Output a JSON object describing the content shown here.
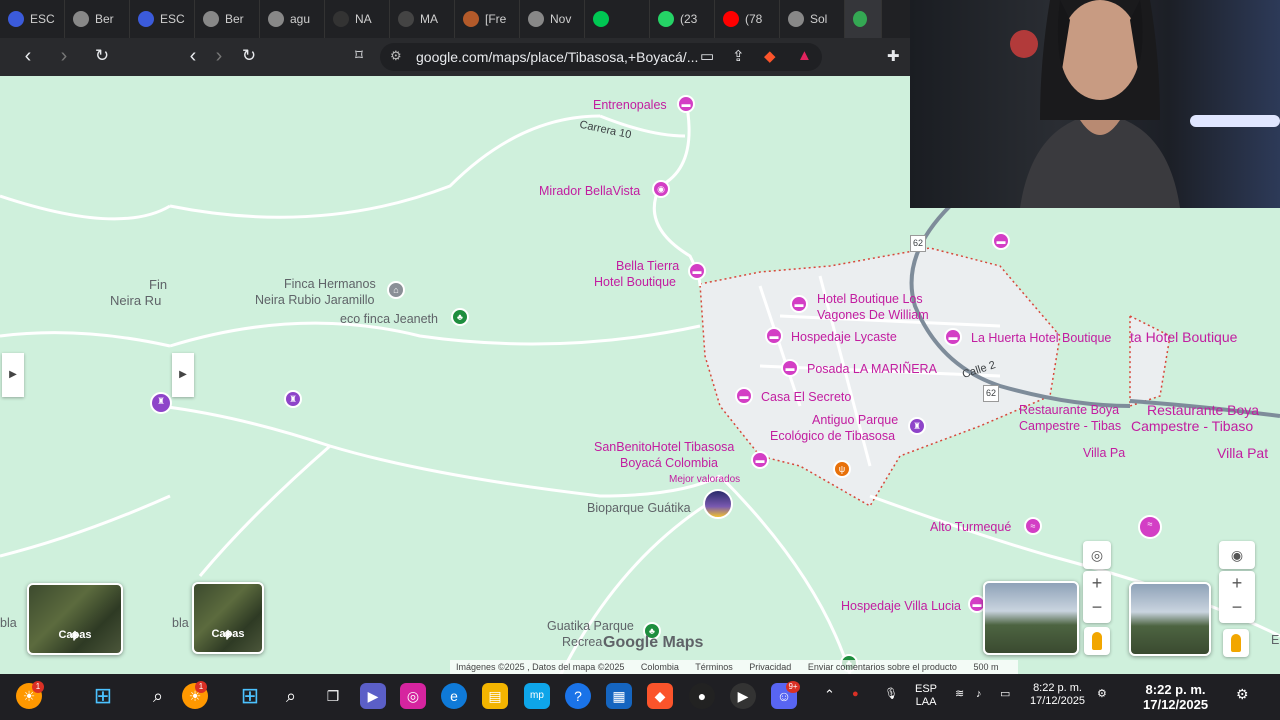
{
  "browser": {
    "tabs": [
      {
        "label": "ESC",
        "color": "#3b5bdb"
      },
      {
        "label": "Ber",
        "color": "#888"
      },
      {
        "label": "ESC",
        "color": "#3b5bdb"
      },
      {
        "label": "Ber",
        "color": "#888"
      },
      {
        "label": "agu",
        "color": "#888"
      },
      {
        "label": "NA",
        "color": "#333"
      },
      {
        "label": "MA",
        "color": "#444"
      },
      {
        "label": "[Fre",
        "color": "#b35a2a"
      },
      {
        "label": "Nov",
        "color": "#888"
      },
      {
        "label": "",
        "color": "#00c853"
      },
      {
        "label": "(23",
        "color": "#25d366"
      },
      {
        "label": "(78",
        "color": "#ff0000"
      },
      {
        "label": "Sol",
        "color": "#888"
      },
      {
        "label": "",
        "color": "#34a853"
      }
    ],
    "url": "google.com/maps/place/Tibasosa,+Boyacá/..."
  },
  "map": {
    "roads": {
      "carrera10": "Carrera 10",
      "calle2": "Calle 2",
      "r62a": "62",
      "r62b": "62"
    },
    "places": {
      "entrenopales": "Entrenopales",
      "mirador": "Mirador BellaVista",
      "bellatierra1": "Bella Tierra",
      "bellatierra2": "Hotel Boutique",
      "finca1": "Finca Hermanos",
      "finca2": "Neira Rubio Jaramillo",
      "ecofinca": "eco finca Jeaneth",
      "fin1": "Fin",
      "fin2": "Neira Ru",
      "hbl1": "Hotel Boutique Los",
      "hbl2": "Vagones De William",
      "lycaste": "Hospedaje Lycaste",
      "lahuerta": "La Huerta Hotel Boutique",
      "lahuerta2": "ta Hotel Boutique",
      "marinera": "Posada LA MARIÑERA",
      "secreto": "Casa El Secreto",
      "parque1": "Antiguo Parque",
      "parque2": "Ecológico de Tibasosa",
      "sanbenito1": "SanBenitoHotel Tibasosa",
      "sanbenito2": "Boyacá Colombia",
      "mejor": "Mejor valorados",
      "bioparque": "Bioparque Guátika",
      "rest1": "Restaurante Boya",
      "rest1b": "Campestre - Tibas",
      "rest2": "Restaurante Boya",
      "rest2b": "Campestre - Tibaso",
      "villapa1": "Villa Pa",
      "villapa2": "Villa Pat",
      "alto": "Alto Turmequé",
      "villalucia": "Hospedaje Villa Lucia",
      "guatika1": "Guatika Parque",
      "guatika2": "Recrea",
      "bla1": "bla",
      "bla2": "bla",
      "e": "E"
    },
    "logo": "Google Maps",
    "layers_label": "Capas",
    "attribution": [
      "Imágenes ©2025 , Datos del mapa ©2025",
      "Colombia",
      "Términos",
      "Privacidad",
      "Enviar comentarios sobre el producto",
      "500 m"
    ]
  },
  "taskbar": {
    "lang1": "ESP",
    "lang2": "LAA",
    "time": "8:22 p. m.",
    "date": "17/12/2025",
    "time2": "8:22 p. m.",
    "date2": "17/12/2025",
    "badge_notif": "1",
    "badge_app": "1",
    "badge_discord": "9+"
  }
}
